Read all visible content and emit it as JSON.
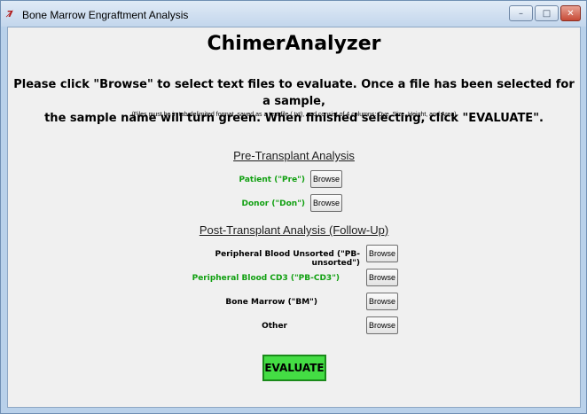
{
  "window": {
    "title": "Bone Marrow Engraftment Analysis",
    "icon_text": "7̸",
    "minimize_glyph": "–",
    "maximize_glyph": "□",
    "close_glyph": "✕"
  },
  "app_title": "ChimerAnalyzer",
  "instructions": {
    "line1": "Please click \"Browse\" to select text files to evaluate.  Once a file has been selected for a sample,",
    "line2": "the sample name will turn green.  When finished selecting, click \"EVALUATE\".",
    "note": "(Files must be in tab-delimited format, saved as a text file (.txt), and consist of 4 columns:  Dye, Size, Height, and Area)"
  },
  "pre": {
    "heading": "Pre-Transplant Analysis",
    "patient_label": "Patient (\"Pre\")",
    "donor_label": "Donor (\"Don\")"
  },
  "post": {
    "heading": "Post-Transplant Analysis (Follow-Up)",
    "pb_unsorted_label": "Peripheral Blood Unsorted (\"PB-unsorted\")",
    "pb_cd3_label": "Peripheral Blood CD3 (\"PB-CD3\")",
    "bm_label": "Bone Marrow (\"BM\")",
    "other_label": "Other"
  },
  "browse_label": "Browse",
  "evaluate_label": "EVALUATE",
  "colors": {
    "selected_green": "#11a011",
    "evaluate_bg": "#44dd44",
    "unselected_text": "#000000"
  }
}
